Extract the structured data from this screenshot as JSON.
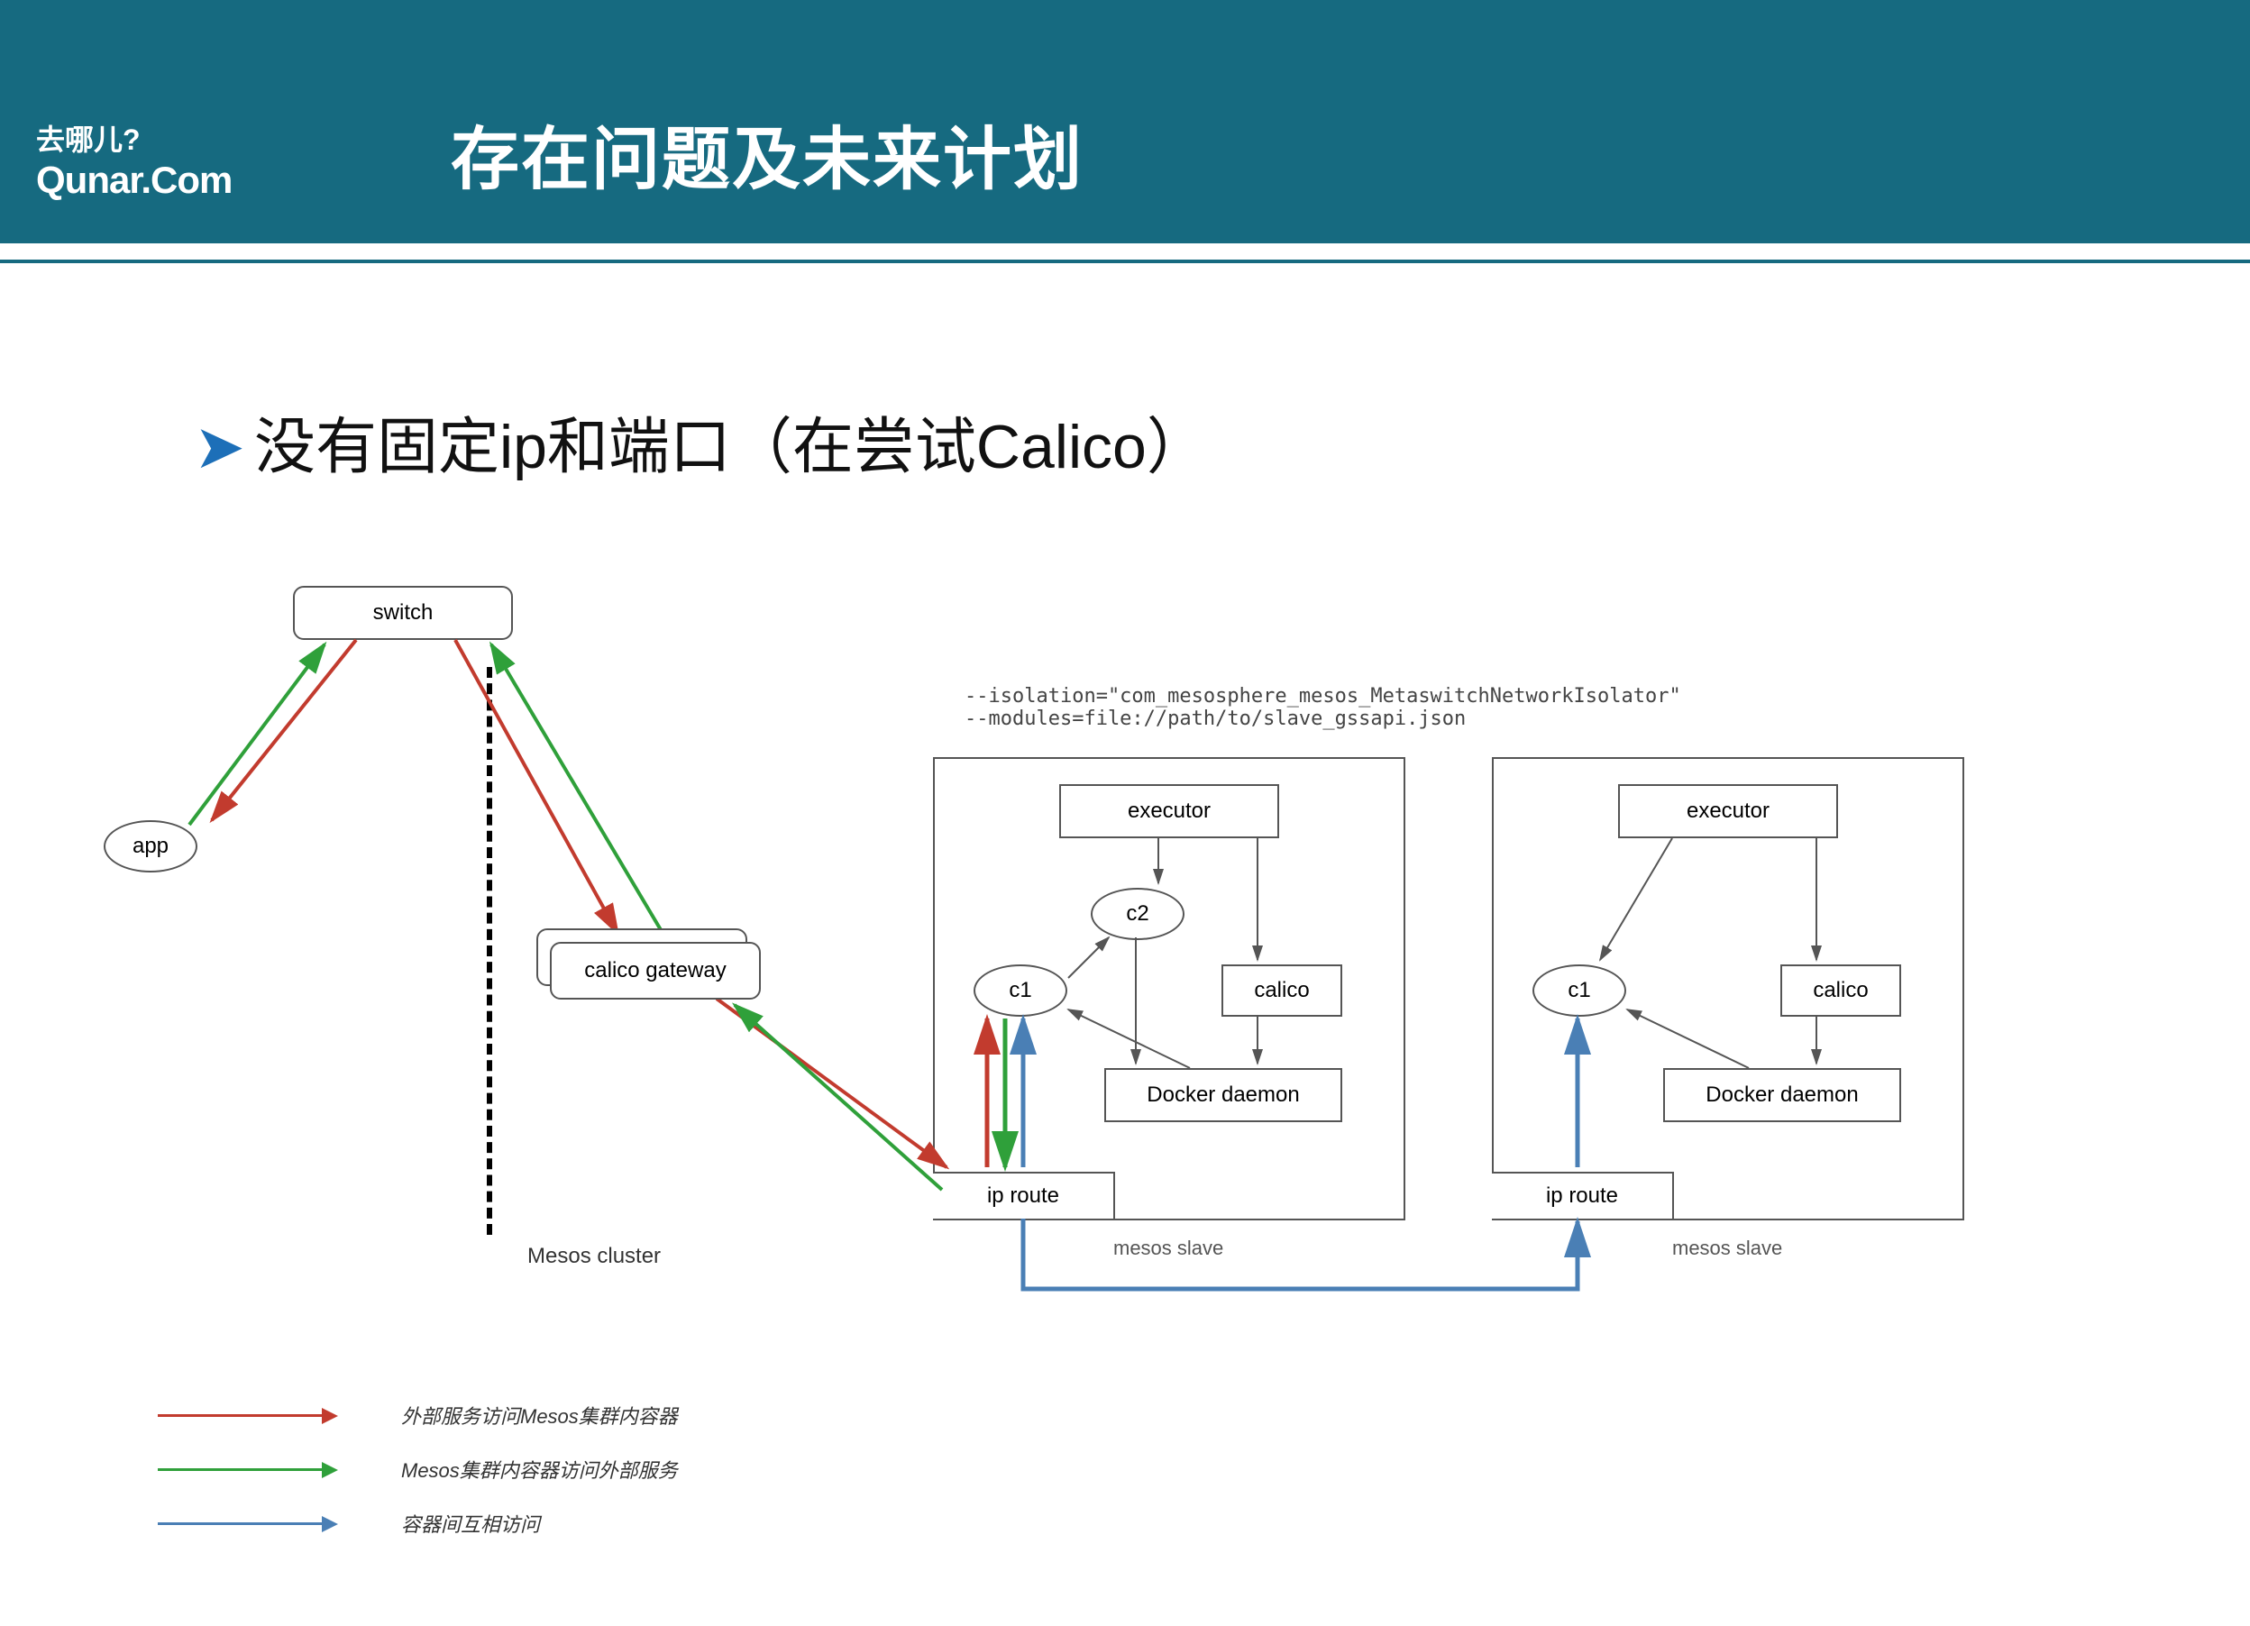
{
  "brand": {
    "cn": "去哪儿?",
    "en": "Qunar.Com"
  },
  "slide_title": "存在问题及未来计划",
  "bullet": "没有固定ip和端口（在尝试Calico）",
  "config_text": "--isolation=\"com_mesosphere_mesos_MetaswitchNetworkIsolator\"\n--modules=file://path/to/slave_gssapi.json",
  "nodes": {
    "switch": "switch",
    "app": "app",
    "calico_gateway": "calico gateway",
    "executor": "executor",
    "c1": "c1",
    "c2": "c2",
    "calico": "calico",
    "docker_daemon": "Docker daemon",
    "ip_route": "ip route",
    "mesos_slave": "mesos slave",
    "mesos_cluster": "Mesos cluster"
  },
  "legend": {
    "red": "外部服务访问Mesos集群内容器",
    "green": "Mesos集群内容器访问外部服务",
    "blue": "容器间互相访问"
  }
}
